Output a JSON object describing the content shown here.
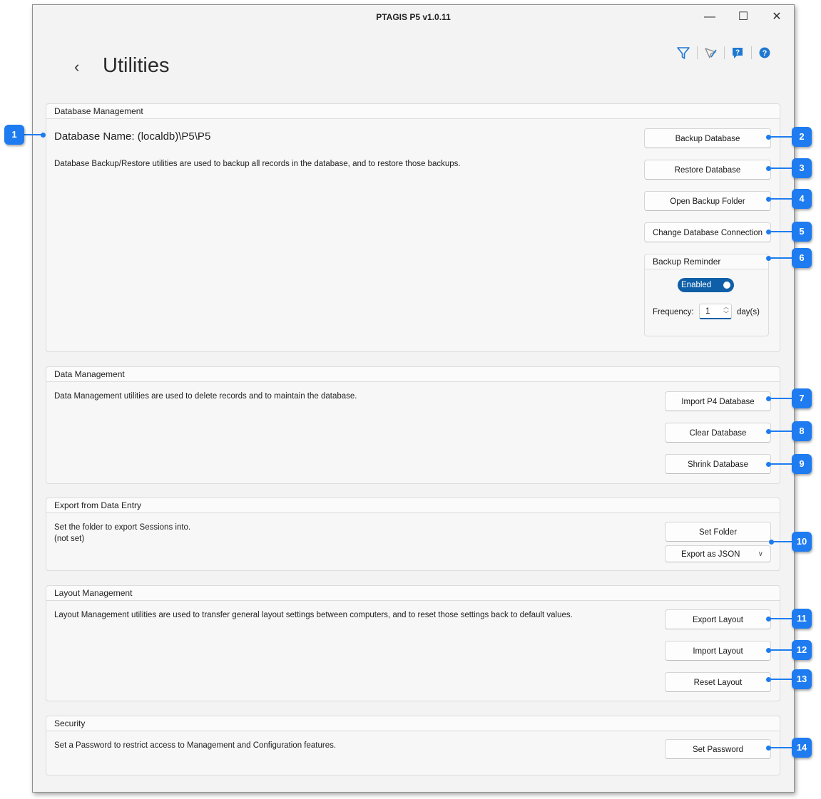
{
  "window": {
    "title": "PTAGIS P5 v1.0.11",
    "minimize": "—",
    "maximize": "☐",
    "close": "✕"
  },
  "page": {
    "title": "Utilities",
    "back": "‹"
  },
  "toolbar_icons": [
    "filter-icon",
    "edit-pen-icon",
    "feedback-icon",
    "help-icon"
  ],
  "database_management": {
    "header": "Database Management",
    "db_name": "Database Name: (localdb)\\P5\\P5",
    "description": "Database Backup/Restore utilities are used to backup all records in the database, and to restore those backups.",
    "backup": "Backup Database",
    "restore": "Restore Database",
    "open_folder": "Open Backup Folder",
    "change_connection": "Change Database Connection",
    "reminder": {
      "header": "Backup Reminder",
      "toggle_label": "Enabled",
      "enabled": true,
      "frequency_label": "Frequency:",
      "frequency_value": "1",
      "unit": "day(s)"
    }
  },
  "data_management": {
    "header": "Data Management",
    "description": "Data Management utilities are used to delete records and to maintain the database.",
    "import_p4": "Import P4 Database",
    "clear": "Clear Database",
    "shrink": "Shrink Database"
  },
  "export": {
    "header": "Export from Data Entry",
    "description": "Set the folder to export Sessions into.",
    "folder_status": "(not set)",
    "set_folder": "Set Folder",
    "format": "Export as JSON"
  },
  "layout_management": {
    "header": "Layout Management",
    "description": "Layout Management utilities are used to transfer general layout settings between computers, and to reset those settings back to default values.",
    "export": "Export Layout",
    "import": "Import Layout",
    "reset": "Reset Layout"
  },
  "security": {
    "header": "Security",
    "description": "Set a Password to restrict access to Management and Configuration features.",
    "set_password": "Set Password"
  },
  "callouts": [
    "1",
    "2",
    "3",
    "4",
    "5",
    "6",
    "7",
    "8",
    "9",
    "10",
    "11",
    "12",
    "13",
    "14"
  ],
  "colors": {
    "accent": "#0f5fa8",
    "callout": "#1e7cf0"
  }
}
